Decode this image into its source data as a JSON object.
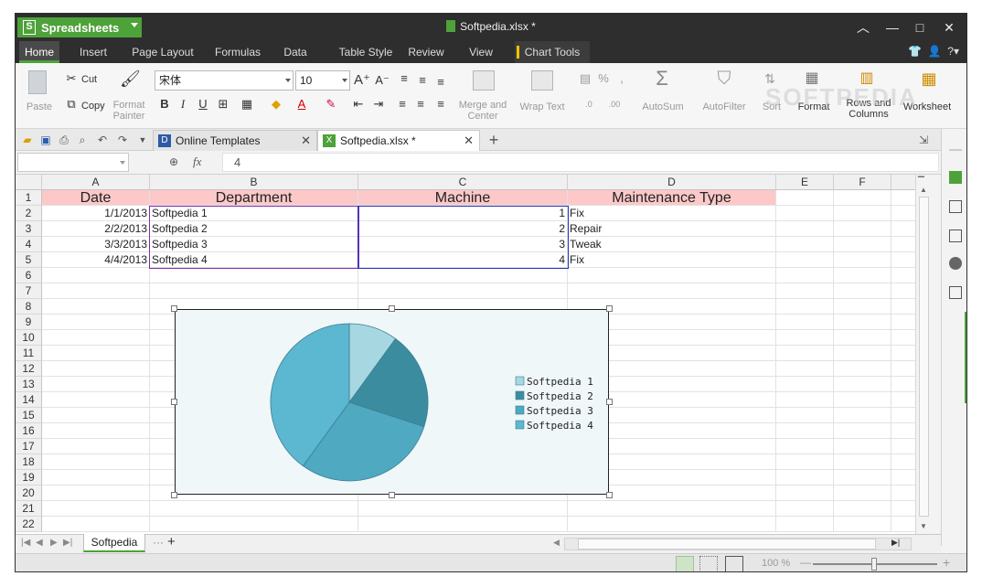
{
  "app": {
    "name": "Spreadsheets",
    "logo_letter": "S",
    "document_title": "Softpedia.xlsx *"
  },
  "menu_tabs": [
    "Home",
    "Insert",
    "Page Layout",
    "Formulas",
    "Data",
    "Table Style",
    "Review",
    "View",
    "Chart Tools"
  ],
  "ribbon": {
    "paste": "Paste",
    "cut": "Cut",
    "copy": "Copy",
    "format_painter_1": "Format",
    "format_painter_2": "Painter",
    "font_name": "宋体",
    "font_size": "10",
    "bold": "B",
    "italic": "I",
    "underline": "U",
    "merge_1": "Merge and",
    "merge_2": "Center",
    "wrap_text": "Wrap Text",
    "autosum": "AutoSum",
    "autofilter": "AutoFilter",
    "sort": "Sort",
    "format": "Format",
    "rows_cols_1": "Rows and",
    "rows_cols_2": "Columns",
    "worksheet": "Worksheet",
    "percent": "%",
    "comma": ","
  },
  "watermark": "SOFTPEDIA",
  "doc_tabs": [
    {
      "label": "Online Templates",
      "active": false
    },
    {
      "label": "Softpedia.xlsx *",
      "active": true
    }
  ],
  "formula_bar": {
    "name_box": "",
    "fx": "fx",
    "value": "4"
  },
  "columns": [
    "A",
    "B",
    "C",
    "D",
    "E",
    "F"
  ],
  "rows": [
    "1",
    "2",
    "3",
    "4",
    "5",
    "6",
    "7",
    "8",
    "9",
    "10",
    "11",
    "12",
    "13",
    "14",
    "15",
    "16",
    "17",
    "18",
    "19",
    "20",
    "21",
    "22"
  ],
  "table": {
    "headers": [
      "Date",
      "Department",
      "Machine",
      "Maintenance Type"
    ],
    "data": [
      [
        "1/1/2013",
        "Softpedia 1",
        "1",
        "Fix"
      ],
      [
        "2/2/2013",
        "Softpedia 2",
        "2",
        "Repair"
      ],
      [
        "3/3/2013",
        "Softpedia 3",
        "3",
        "Tweak"
      ],
      [
        "4/4/2013",
        "Softpedia 4",
        "4",
        "Fix"
      ]
    ]
  },
  "chart_data": {
    "type": "pie",
    "categories": [
      "Softpedia 1",
      "Softpedia 2",
      "Softpedia 3",
      "Softpedia 4"
    ],
    "values": [
      1,
      2,
      3,
      4
    ],
    "colors": [
      "#a7d7e1",
      "#3c8ca0",
      "#4ea9c1",
      "#5cb7d0"
    ],
    "legend": "right"
  },
  "sheet_tabs": [
    "Softpedia"
  ],
  "status": {
    "zoom": "100 %"
  },
  "colors": {
    "accent": "#4da239",
    "header_fill": "#fcc8c8",
    "chart_bg": "#f0f7f9"
  }
}
